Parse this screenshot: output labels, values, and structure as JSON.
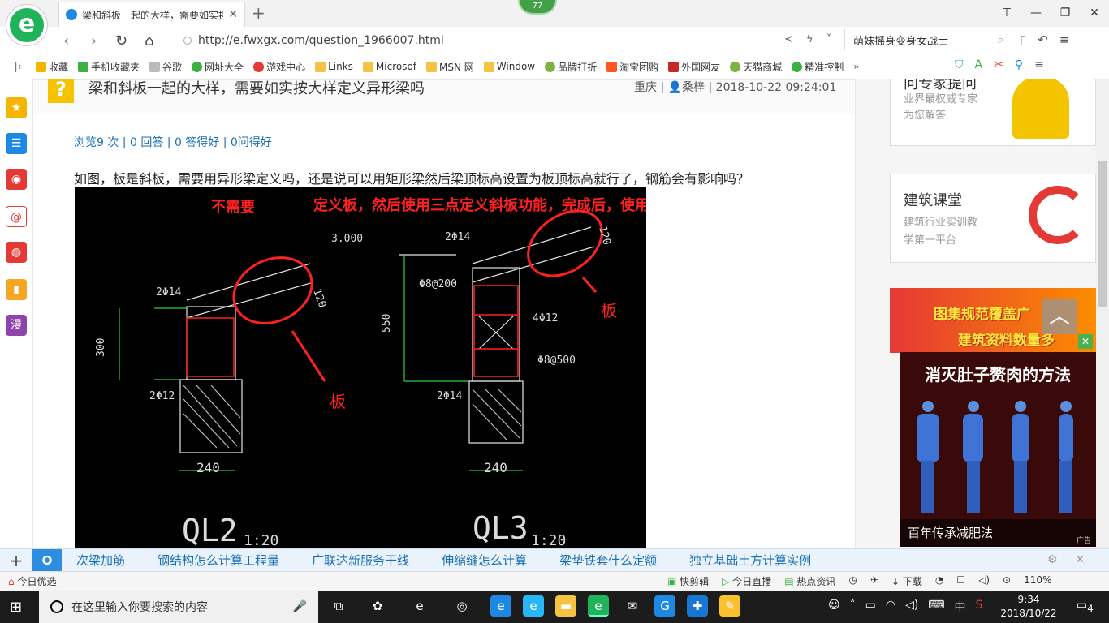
{
  "browser": {
    "tab_title": "梁和斜板一起的大样，需要如实按",
    "tab_close": "✕",
    "new_tab": "+",
    "badge": "77",
    "url": "http://e.fwxgx.com/question_1966007.html",
    "search_text": "萌妹摇身变身女战士",
    "window_controls": [
      "⊤",
      "—",
      "❐",
      "✕"
    ]
  },
  "bookmarks": [
    {
      "label": "收藏",
      "icon": "star-icon",
      "color": "#f5b400"
    },
    {
      "label": "手机收藏夹",
      "icon": "phone-icon",
      "color": "#3cb043"
    },
    {
      "label": "谷歌",
      "icon": "page-icon",
      "color": "#bbbbbb"
    },
    {
      "label": "网址大全",
      "icon": "globe-icon",
      "color": "#3cb043"
    },
    {
      "label": "游戏中心",
      "icon": "game-icon",
      "color": "#e53935"
    },
    {
      "label": "Links",
      "icon": "folder-icon",
      "color": "#f5c242"
    },
    {
      "label": "Microsof",
      "icon": "folder-icon",
      "color": "#f5c242"
    },
    {
      "label": "MSN 网",
      "icon": "folder-icon",
      "color": "#f5c242"
    },
    {
      "label": "Window",
      "icon": "folder-icon",
      "color": "#f5c242"
    },
    {
      "label": "品牌打折",
      "icon": "leaf-icon",
      "color": "#7cb342"
    },
    {
      "label": "淘宝团购",
      "icon": "taobao-icon",
      "color": "#ff5722"
    },
    {
      "label": "外国网友",
      "icon": "news-icon",
      "color": "#c62828"
    },
    {
      "label": "天猫商城",
      "icon": "leaf-icon",
      "color": "#7cb342"
    },
    {
      "label": "精准控制",
      "icon": "chat-icon",
      "color": "#3cb043"
    }
  ],
  "question": {
    "title": "梁和斜板一起的大样，需要如实按大样定义异形梁吗",
    "meta": "重庆 | 👤桑梓 | 2018-10-22 09:24:01",
    "stats": "浏览9 次 | 0 回答 | 0 答得好 | 0问得好",
    "text": "如图，板是斜板，需要用异形梁定义吗，还是说可以用矩形梁然后梁顶标高设置为板顶标高就行了，钢筋会有影响吗？"
  },
  "cad": {
    "annot_left": "不需要",
    "annot_main": "定义板，然后使用三点定义斜板功能，完成后，使用平齐板顶功能",
    "board_label": "板",
    "ql2": {
      "name": "QL2",
      "scale": "1:20",
      "top": "2Φ14",
      "bottom": "2Φ12",
      "height": "300",
      "width": "240",
      "slab": "120"
    },
    "ql3": {
      "name": "QL3",
      "scale": "1:20",
      "elev": "3.000",
      "top": "2Φ14",
      "stirrup": "Φ8@200",
      "mid": "4Φ12",
      "tie": "Φ8@500",
      "bottom": "2Φ14",
      "height": "550",
      "width": "240",
      "slab": "120"
    }
  },
  "rail": {
    "expert_title": "问专家提问",
    "expert_sub": [
      "业界最权威专家",
      "为您解答"
    ],
    "course_title": "建筑课堂",
    "course_sub": [
      "建筑行业实训教",
      "学第一平台"
    ],
    "banner_line1": "图集规范覆盖广",
    "banner_line2": "建筑资料数量多"
  },
  "ad": {
    "title": "消灭肚子赘肉的方法",
    "caption": "百年传承减肥法",
    "tag": "广告"
  },
  "hotbar": {
    "items": [
      "次梁加筋",
      "钢结构怎么计算工程量",
      "广联达新服务干线",
      "伸缩缝怎么计算",
      "梁垫铁套什么定额",
      "独立基础土方计算实例"
    ]
  },
  "status": {
    "left": "今日优选",
    "right": [
      "快剪辑",
      "今日直播",
      "热点资讯",
      "下载",
      "110%"
    ]
  },
  "taskbar": {
    "search_placeholder": "在这里输入你要搜索的内容",
    "ime": "中",
    "time": "9:34",
    "date": "2018/10/22",
    "notifications": "4"
  }
}
